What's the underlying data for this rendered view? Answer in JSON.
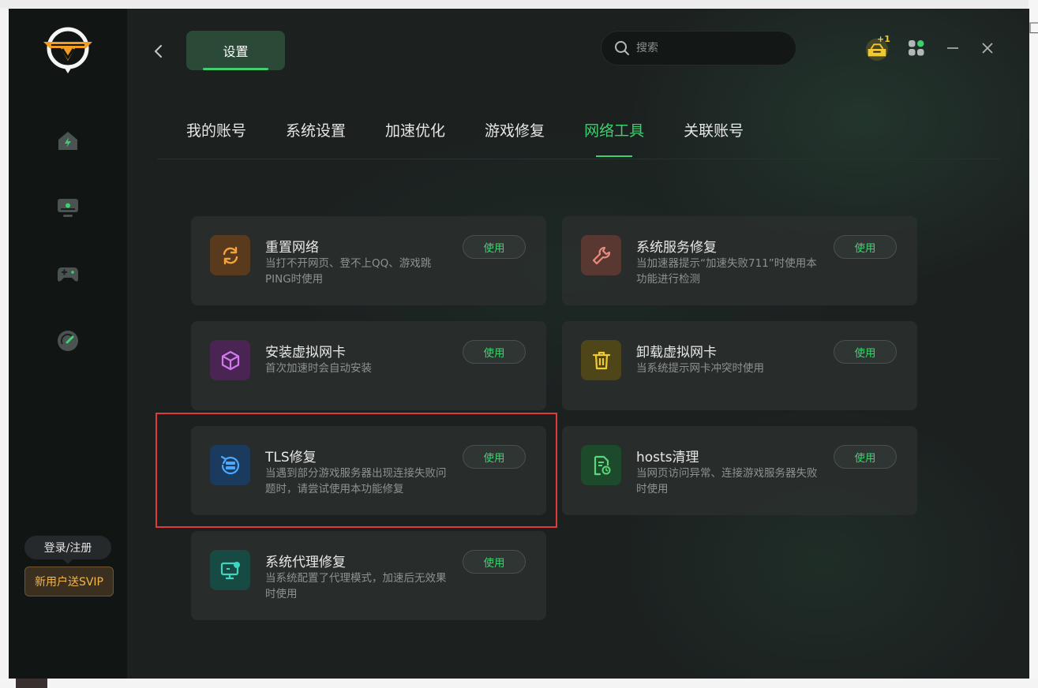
{
  "header": {
    "settings_tab": "设置",
    "search_placeholder": "搜索",
    "badge_plus": "+1"
  },
  "sidebar": {
    "login_label": "登录/注册",
    "vip_promo": "新用户送SVIP",
    "nav": [
      "home-icon",
      "monitor-icon",
      "gamepad-icon",
      "speedometer-icon"
    ]
  },
  "tabs": [
    {
      "label": "我的账号"
    },
    {
      "label": "系统设置"
    },
    {
      "label": "加速优化"
    },
    {
      "label": "游戏修复"
    },
    {
      "label": "网络工具",
      "active": true
    },
    {
      "label": "关联账号"
    }
  ],
  "tools": [
    {
      "title": "重置网络",
      "desc": "当打不开网页、登不上QQ、游戏跳PING时使用",
      "button": "使用",
      "icon": "refresh-icon",
      "color": "#f0a23c"
    },
    {
      "title": "系统服务修复",
      "desc": "当加速器提示“加速失败711”时使用本功能进行检测",
      "button": "使用",
      "icon": "wrench-icon",
      "color": "#e88b7d"
    },
    {
      "title": "安装虚拟网卡",
      "desc": "首次加速时会自动安装",
      "button": "使用",
      "icon": "cube-icon",
      "color": "#d178f0"
    },
    {
      "title": "卸载虚拟网卡",
      "desc": "当系统提示网卡冲突时使用",
      "button": "使用",
      "icon": "trash-icon",
      "color": "#f1c933"
    },
    {
      "title": "TLS修复",
      "desc": "当遇到部分游戏服务器出现连接失败问题时，请尝试使用本功能修复",
      "button": "使用",
      "icon": "server-repair-icon",
      "color": "#4aa8ff"
    },
    {
      "title": "hosts清理",
      "desc": "当网页访问异常、连接游戏服务器失败时使用",
      "button": "使用",
      "icon": "file-clean-icon",
      "color": "#5cd678"
    },
    {
      "title": "系统代理修复",
      "desc": "当系统配置了代理模式，加速后无效果时使用",
      "button": "使用",
      "icon": "monitor-proxy-icon",
      "color": "#3fd6c0"
    }
  ]
}
